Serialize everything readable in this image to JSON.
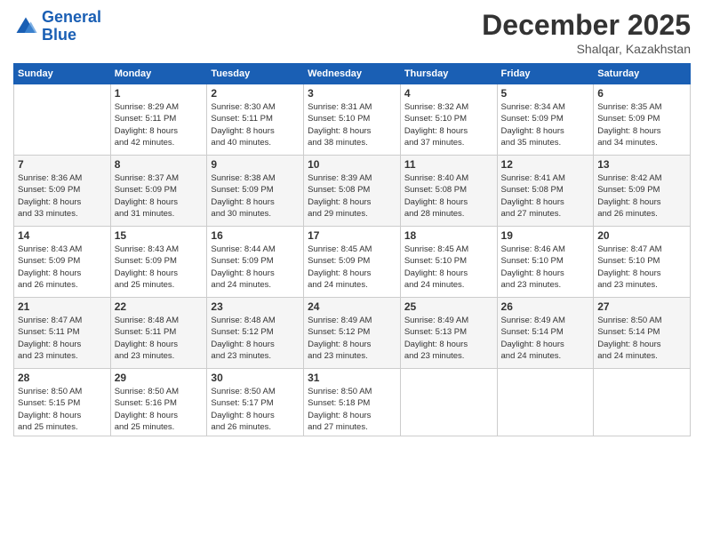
{
  "logo": {
    "line1": "General",
    "line2": "Blue"
  },
  "title": "December 2025",
  "subtitle": "Shalqar, Kazakhstan",
  "days_of_week": [
    "Sunday",
    "Monday",
    "Tuesday",
    "Wednesday",
    "Thursday",
    "Friday",
    "Saturday"
  ],
  "weeks": [
    [
      {
        "day": "",
        "info": ""
      },
      {
        "day": "1",
        "info": "Sunrise: 8:29 AM\nSunset: 5:11 PM\nDaylight: 8 hours\nand 42 minutes."
      },
      {
        "day": "2",
        "info": "Sunrise: 8:30 AM\nSunset: 5:11 PM\nDaylight: 8 hours\nand 40 minutes."
      },
      {
        "day": "3",
        "info": "Sunrise: 8:31 AM\nSunset: 5:10 PM\nDaylight: 8 hours\nand 38 minutes."
      },
      {
        "day": "4",
        "info": "Sunrise: 8:32 AM\nSunset: 5:10 PM\nDaylight: 8 hours\nand 37 minutes."
      },
      {
        "day": "5",
        "info": "Sunrise: 8:34 AM\nSunset: 5:09 PM\nDaylight: 8 hours\nand 35 minutes."
      },
      {
        "day": "6",
        "info": "Sunrise: 8:35 AM\nSunset: 5:09 PM\nDaylight: 8 hours\nand 34 minutes."
      }
    ],
    [
      {
        "day": "7",
        "info": "Sunrise: 8:36 AM\nSunset: 5:09 PM\nDaylight: 8 hours\nand 33 minutes."
      },
      {
        "day": "8",
        "info": "Sunrise: 8:37 AM\nSunset: 5:09 PM\nDaylight: 8 hours\nand 31 minutes."
      },
      {
        "day": "9",
        "info": "Sunrise: 8:38 AM\nSunset: 5:09 PM\nDaylight: 8 hours\nand 30 minutes."
      },
      {
        "day": "10",
        "info": "Sunrise: 8:39 AM\nSunset: 5:08 PM\nDaylight: 8 hours\nand 29 minutes."
      },
      {
        "day": "11",
        "info": "Sunrise: 8:40 AM\nSunset: 5:08 PM\nDaylight: 8 hours\nand 28 minutes."
      },
      {
        "day": "12",
        "info": "Sunrise: 8:41 AM\nSunset: 5:08 PM\nDaylight: 8 hours\nand 27 minutes."
      },
      {
        "day": "13",
        "info": "Sunrise: 8:42 AM\nSunset: 5:09 PM\nDaylight: 8 hours\nand 26 minutes."
      }
    ],
    [
      {
        "day": "14",
        "info": "Sunrise: 8:43 AM\nSunset: 5:09 PM\nDaylight: 8 hours\nand 26 minutes."
      },
      {
        "day": "15",
        "info": "Sunrise: 8:43 AM\nSunset: 5:09 PM\nDaylight: 8 hours\nand 25 minutes."
      },
      {
        "day": "16",
        "info": "Sunrise: 8:44 AM\nSunset: 5:09 PM\nDaylight: 8 hours\nand 24 minutes."
      },
      {
        "day": "17",
        "info": "Sunrise: 8:45 AM\nSunset: 5:09 PM\nDaylight: 8 hours\nand 24 minutes."
      },
      {
        "day": "18",
        "info": "Sunrise: 8:45 AM\nSunset: 5:10 PM\nDaylight: 8 hours\nand 24 minutes."
      },
      {
        "day": "19",
        "info": "Sunrise: 8:46 AM\nSunset: 5:10 PM\nDaylight: 8 hours\nand 23 minutes."
      },
      {
        "day": "20",
        "info": "Sunrise: 8:47 AM\nSunset: 5:10 PM\nDaylight: 8 hours\nand 23 minutes."
      }
    ],
    [
      {
        "day": "21",
        "info": "Sunrise: 8:47 AM\nSunset: 5:11 PM\nDaylight: 8 hours\nand 23 minutes."
      },
      {
        "day": "22",
        "info": "Sunrise: 8:48 AM\nSunset: 5:11 PM\nDaylight: 8 hours\nand 23 minutes."
      },
      {
        "day": "23",
        "info": "Sunrise: 8:48 AM\nSunset: 5:12 PM\nDaylight: 8 hours\nand 23 minutes."
      },
      {
        "day": "24",
        "info": "Sunrise: 8:49 AM\nSunset: 5:12 PM\nDaylight: 8 hours\nand 23 minutes."
      },
      {
        "day": "25",
        "info": "Sunrise: 8:49 AM\nSunset: 5:13 PM\nDaylight: 8 hours\nand 23 minutes."
      },
      {
        "day": "26",
        "info": "Sunrise: 8:49 AM\nSunset: 5:14 PM\nDaylight: 8 hours\nand 24 minutes."
      },
      {
        "day": "27",
        "info": "Sunrise: 8:50 AM\nSunset: 5:14 PM\nDaylight: 8 hours\nand 24 minutes."
      }
    ],
    [
      {
        "day": "28",
        "info": "Sunrise: 8:50 AM\nSunset: 5:15 PM\nDaylight: 8 hours\nand 25 minutes."
      },
      {
        "day": "29",
        "info": "Sunrise: 8:50 AM\nSunset: 5:16 PM\nDaylight: 8 hours\nand 25 minutes."
      },
      {
        "day": "30",
        "info": "Sunrise: 8:50 AM\nSunset: 5:17 PM\nDaylight: 8 hours\nand 26 minutes."
      },
      {
        "day": "31",
        "info": "Sunrise: 8:50 AM\nSunset: 5:18 PM\nDaylight: 8 hours\nand 27 minutes."
      },
      {
        "day": "",
        "info": ""
      },
      {
        "day": "",
        "info": ""
      },
      {
        "day": "",
        "info": ""
      }
    ]
  ]
}
